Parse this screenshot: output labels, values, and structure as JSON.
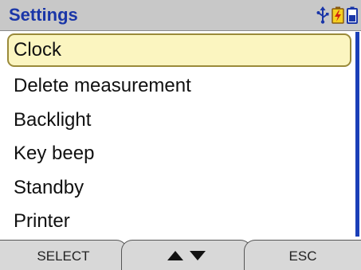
{
  "title": "Settings",
  "status_icons": [
    "usb-connection-icon",
    "battery-charging-icon",
    "battery-level-icon"
  ],
  "menu": {
    "items": [
      {
        "label": "Clock",
        "selected": true
      },
      {
        "label": "Delete measurement",
        "selected": false
      },
      {
        "label": "Backlight",
        "selected": false
      },
      {
        "label": "Key beep",
        "selected": false
      },
      {
        "label": "Standby",
        "selected": false
      },
      {
        "label": "Printer",
        "selected": false
      }
    ]
  },
  "softkeys": {
    "left": "SELECT",
    "middle_icons": [
      "arrow-up-icon",
      "arrow-down-icon"
    ],
    "right": "ESC"
  },
  "colors": {
    "title_text": "#1a36a8",
    "title_bar": "#c8c8c8",
    "selection_fill": "#fbf5c0",
    "selection_border": "#9a8a3a",
    "scrollbar": "#1a3fb8",
    "softkey_bg": "#d8d8d8"
  }
}
